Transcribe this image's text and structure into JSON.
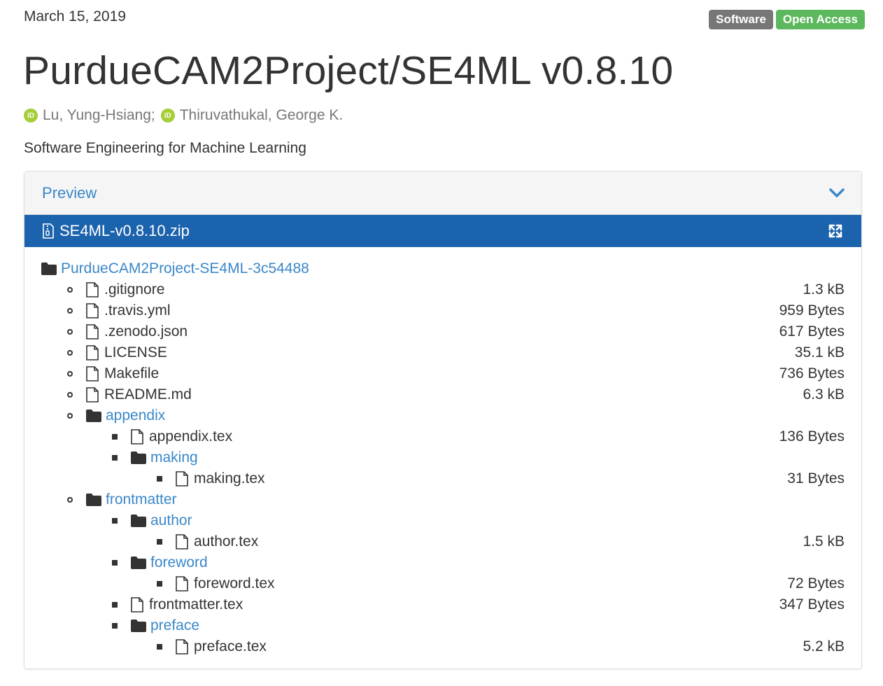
{
  "header": {
    "date": "March 15, 2019",
    "badges": [
      "Software",
      "Open Access"
    ],
    "title": "PurdueCAM2Project/SE4ML v0.8.10",
    "authors": [
      "Lu, Yung-Hsiang;",
      "Thiruvathukal, George K."
    ],
    "orcid_glyph": "iD",
    "description": "Software Engineering for Machine Learning"
  },
  "panel": {
    "title": "Preview",
    "file_name": "SE4ML-v0.8.10.zip",
    "colors": {
      "link": "#3a87c8",
      "bar": "#1c63ad",
      "orcid": "#a6ce39"
    }
  },
  "tree": [
    {
      "name": "PurdueCAM2Project-SE4ML-3c54488",
      "type": "folder",
      "depth": 0,
      "size": ""
    },
    {
      "name": ".gitignore",
      "type": "file",
      "depth": 1,
      "size": "1.3 kB"
    },
    {
      "name": ".travis.yml",
      "type": "file",
      "depth": 1,
      "size": "959 Bytes"
    },
    {
      "name": ".zenodo.json",
      "type": "file",
      "depth": 1,
      "size": "617 Bytes"
    },
    {
      "name": "LICENSE",
      "type": "file",
      "depth": 1,
      "size": "35.1 kB"
    },
    {
      "name": "Makefile",
      "type": "file",
      "depth": 1,
      "size": "736 Bytes"
    },
    {
      "name": "README.md",
      "type": "file",
      "depth": 1,
      "size": "6.3 kB"
    },
    {
      "name": "appendix",
      "type": "folder",
      "depth": 1,
      "size": ""
    },
    {
      "name": "appendix.tex",
      "type": "file",
      "depth": 2,
      "size": "136 Bytes"
    },
    {
      "name": "making",
      "type": "folder",
      "depth": 2,
      "size": ""
    },
    {
      "name": "making.tex",
      "type": "file",
      "depth": 3,
      "size": "31 Bytes"
    },
    {
      "name": "frontmatter",
      "type": "folder",
      "depth": 1,
      "size": ""
    },
    {
      "name": "author",
      "type": "folder",
      "depth": 2,
      "size": ""
    },
    {
      "name": "author.tex",
      "type": "file",
      "depth": 3,
      "size": "1.5 kB"
    },
    {
      "name": "foreword",
      "type": "folder",
      "depth": 2,
      "size": ""
    },
    {
      "name": "foreword.tex",
      "type": "file",
      "depth": 3,
      "size": "72 Bytes"
    },
    {
      "name": "frontmatter.tex",
      "type": "file",
      "depth": 2,
      "size": "347 Bytes"
    },
    {
      "name": "preface",
      "type": "folder",
      "depth": 2,
      "size": ""
    },
    {
      "name": "preface.tex",
      "type": "file",
      "depth": 3,
      "size": "5.2 kB"
    }
  ]
}
